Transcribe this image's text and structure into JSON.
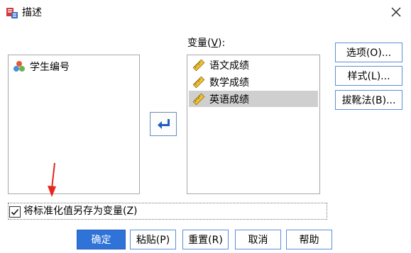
{
  "window": {
    "title": "描述",
    "close_icon": "close-icon"
  },
  "colors": {
    "accent": "#2f72d8",
    "selection": "#cfcfcf",
    "annotation": "#e8251c"
  },
  "source_list": {
    "items": [
      {
        "label": "学生编号",
        "icon": "nominal-variable-icon"
      }
    ]
  },
  "target": {
    "label_prefix": "变量(",
    "label_mnemonic": "V",
    "label_suffix": "):",
    "items": [
      {
        "label": "语文成绩",
        "icon": "scale-ruler-icon",
        "selected": false
      },
      {
        "label": "数学成绩",
        "icon": "scale-ruler-icon",
        "selected": false
      },
      {
        "label": "英语成绩",
        "icon": "scale-ruler-icon",
        "selected": true
      }
    ]
  },
  "side_buttons": {
    "options": "选项(O)...",
    "style": "样式(L)...",
    "bootstrap": "拔靴法(B)..."
  },
  "save_standardized": {
    "label": "将标准化值另存为变量(Z)",
    "checked": true
  },
  "bottom_buttons": {
    "ok": "确定",
    "paste": "粘贴(P)",
    "reset": "重置(R)",
    "cancel": "取消",
    "help": "帮助"
  }
}
